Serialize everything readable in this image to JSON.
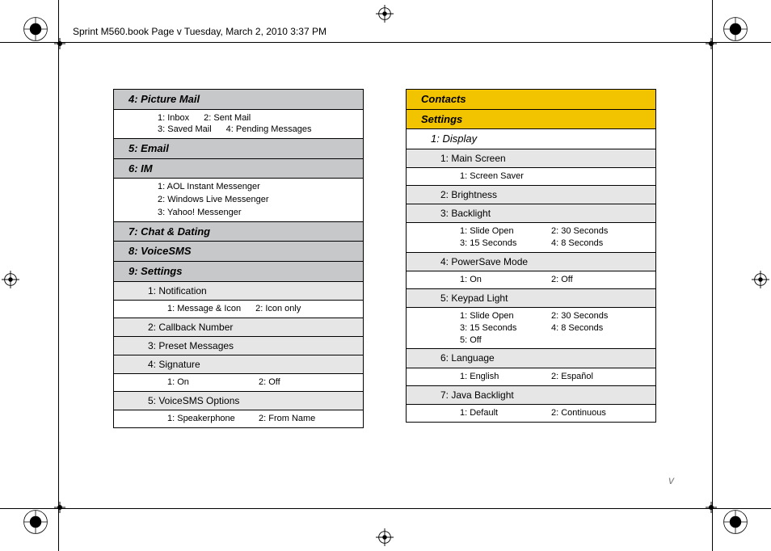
{
  "book_header": "Sprint M560.book  Page v  Tuesday, March 2, 2010  3:37 PM",
  "page_number": "v",
  "left": {
    "picture_mail": {
      "title": "4: Picture Mail",
      "opts": [
        "1: Inbox",
        "2: Sent Mail",
        "3: Saved Mail",
        "4: Pending Messages"
      ]
    },
    "email": {
      "title": "5: Email"
    },
    "im": {
      "title": "6: IM",
      "opts": [
        "1: AOL Instant Messenger",
        "2: Windows Live Messenger",
        "3: Yahoo! Messenger"
      ]
    },
    "chat_dating": {
      "title": "7: Chat & Dating"
    },
    "voicesms": {
      "title": "8: VoiceSMS"
    },
    "settings": {
      "title": "9: Settings",
      "notification": {
        "title": "1: Notification",
        "opts": [
          "1: Message & Icon",
          "2: Icon only"
        ]
      },
      "callback": {
        "title": "2: Callback Number"
      },
      "preset": {
        "title": "3: Preset Messages"
      },
      "signature": {
        "title": "4: Signature",
        "opts": [
          "1: On",
          "2: Off"
        ]
      },
      "vsms_opts": {
        "title": "5: VoiceSMS Options",
        "opts": [
          "1: Speakerphone",
          "2: From Name"
        ]
      }
    }
  },
  "right": {
    "contacts": {
      "title": "Contacts"
    },
    "settings": {
      "title": "Settings",
      "display": {
        "title": "1: Display",
        "main_screen": {
          "title": "1: Main Screen",
          "opts": [
            "1: Screen Saver"
          ]
        },
        "brightness": {
          "title": "2: Brightness"
        },
        "backlight": {
          "title": "3: Backlight",
          "opts": [
            "1: Slide Open",
            "2: 30 Seconds",
            "3: 15 Seconds",
            "4: 8 Seconds"
          ]
        },
        "powersave": {
          "title": "4: PowerSave Mode",
          "opts": [
            "1: On",
            "2: Off"
          ]
        },
        "keypad": {
          "title": "5: Keypad Light",
          "opts": [
            "1: Slide Open",
            "2: 30 Seconds",
            "3: 15 Seconds",
            "4: 8 Seconds",
            "5: Off"
          ]
        },
        "language": {
          "title": "6: Language",
          "opts": [
            "1: English",
            "2: Español"
          ]
        },
        "java": {
          "title": "7: Java Backlight",
          "opts": [
            "1: Default",
            "2: Continuous"
          ]
        }
      }
    }
  }
}
